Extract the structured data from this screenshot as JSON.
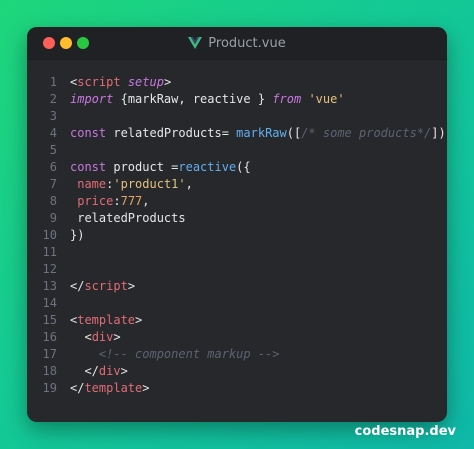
{
  "window": {
    "filename": "Product.vue"
  },
  "brand": "codesnap.dev",
  "colors": {
    "background_start": "#1ed67a",
    "background_end": "#0fb8a8",
    "window_bg": "#27282c",
    "close": "#fe5f57",
    "minimize": "#febc2e",
    "maximize": "#28c840",
    "vue_icon": "#41b883"
  },
  "code": {
    "line_numbers": [
      "1",
      "2",
      "3",
      "4",
      "5",
      "6",
      "7",
      "8",
      "9",
      "10",
      "11",
      "12",
      "13",
      "14",
      "15",
      "16",
      "17",
      "18",
      "19"
    ],
    "l1": {
      "open": "<",
      "tag": "script",
      "attr": " setup",
      "close": ">"
    },
    "l2": {
      "import": "import",
      "braces_open": " {",
      "names": "markRaw, reactive ",
      "braces_close": "}",
      "from": " from ",
      "module": "'vue'"
    },
    "l4": {
      "const": "const",
      "name": " relatedProducts= ",
      "fn": "markRaw",
      "open": "([",
      "comment": "/* some products*/",
      "close": "])"
    },
    "l6": {
      "const": "const",
      "name": " product =",
      "fn": "reactive",
      "open": "({"
    },
    "l7": {
      "indent": " ",
      "key": "name",
      "colon": ":",
      "value": "'product1'",
      "comma": ","
    },
    "l8": {
      "indent": " ",
      "key": "price",
      "colon": ":",
      "value": "777",
      "comma": ","
    },
    "l9": {
      "text": " relatedProducts"
    },
    "l10": {
      "text": "})"
    },
    "l13": {
      "open": "</",
      "tag": "script",
      "close": ">"
    },
    "l15": {
      "open": "<",
      "tag": "template",
      "close": ">"
    },
    "l16": {
      "indent": "  ",
      "open": "<",
      "tag": "div",
      "close": ">"
    },
    "l17": {
      "indent": "    ",
      "comment": "<!-- component markup -->"
    },
    "l18": {
      "indent": "  ",
      "open": "</",
      "tag": "div",
      "close": ">"
    },
    "l19": {
      "open": "</",
      "tag": "template",
      "close": ">"
    }
  }
}
